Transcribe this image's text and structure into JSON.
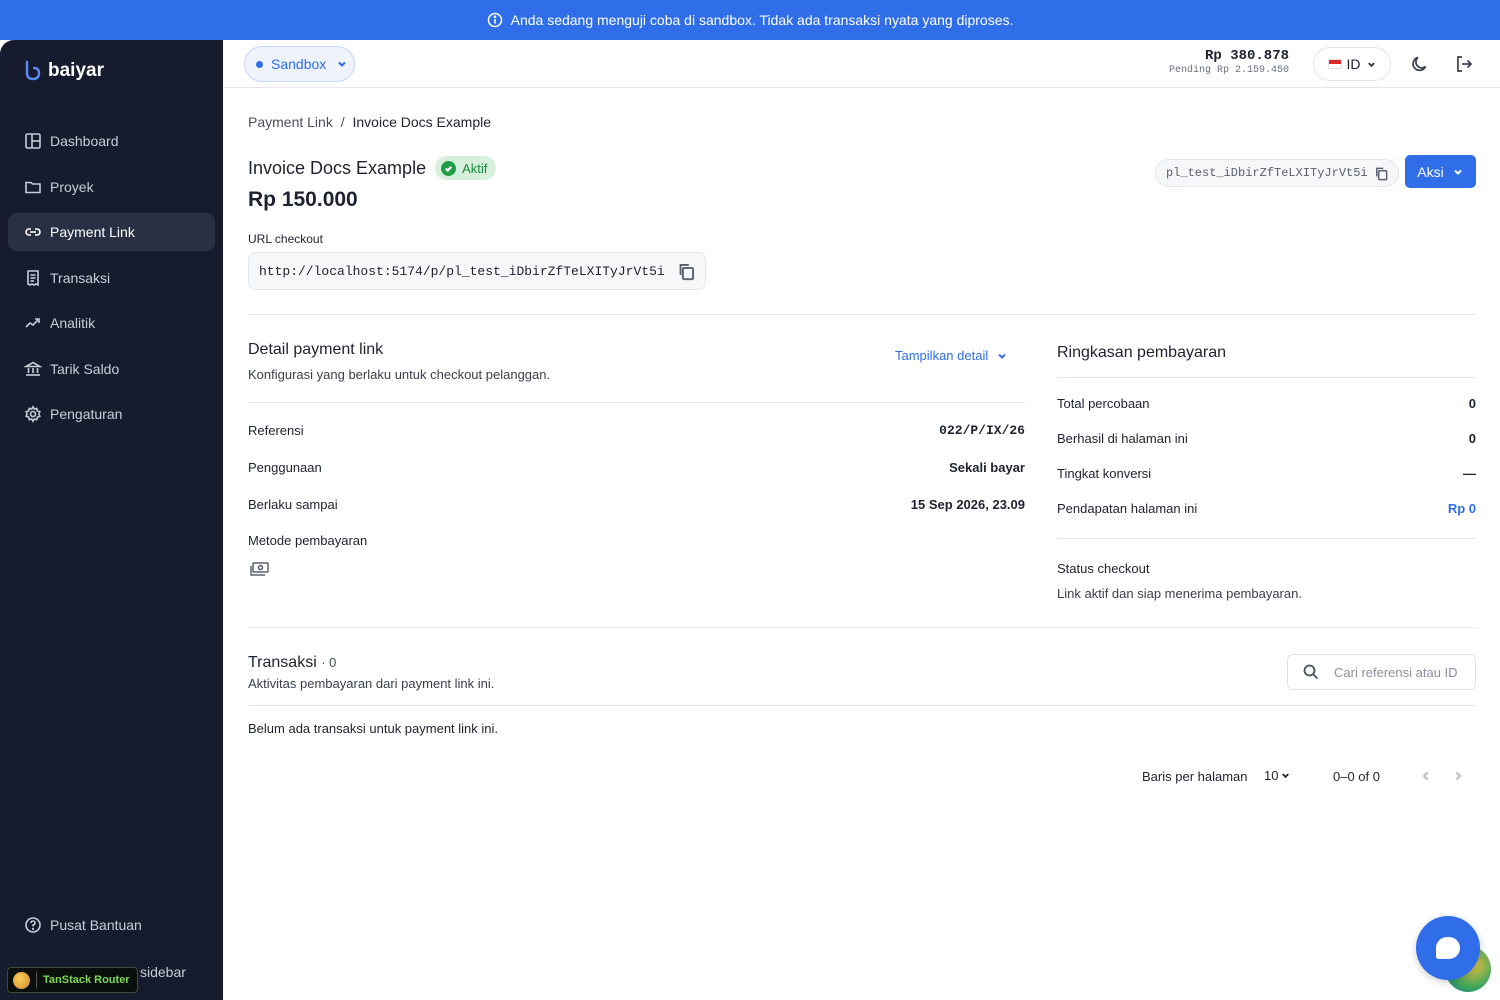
{
  "banner": {
    "text": "Anda sedang menguji coba di sandbox. Tidak ada transaksi nyata yang diproses."
  },
  "brand": {
    "name": "baiyar"
  },
  "sidebar": {
    "items": [
      {
        "label": "Dashboard",
        "icon": "layout-icon"
      },
      {
        "label": "Proyek",
        "icon": "folder-icon"
      },
      {
        "label": "Payment Link",
        "icon": "link-icon",
        "active": true
      },
      {
        "label": "Transaksi",
        "icon": "receipt-icon"
      },
      {
        "label": "Analitik",
        "icon": "trend-icon"
      },
      {
        "label": "Tarik Saldo",
        "icon": "bank-icon"
      },
      {
        "label": "Pengaturan",
        "icon": "gear-icon"
      }
    ],
    "help_label": "Pusat Bantuan",
    "toggle_label": "sidebar"
  },
  "devtools": {
    "label": "TanStack Router"
  },
  "topbar": {
    "env_label": "Sandbox",
    "balance": "Rp 380.878",
    "pending": "Pending Rp 2.159.450",
    "language": "ID"
  },
  "breadcrumb": {
    "parent": "Payment Link",
    "separator": "/",
    "current": "Invoice Docs Example"
  },
  "link": {
    "title": "Invoice Docs Example",
    "status": "Aktif",
    "amount": "Rp 150.000",
    "id": "pl_test_iDbirZfTeLXITyJrVt5i",
    "action_label": "Aksi",
    "url_label": "URL checkout",
    "url": "http://localhost:5174/p/pl_test_iDbirZfTeLXITyJrVt5i"
  },
  "detail": {
    "title": "Detail payment link",
    "subtitle": "Konfigurasi yang berlaku untuk checkout pelanggan.",
    "toggle_label": "Tampilkan detail",
    "rows": [
      {
        "label": "Referensi",
        "value": "022/P/IX/26"
      },
      {
        "label": "Penggunaan",
        "value": "Sekali bayar"
      },
      {
        "label": "Berlaku sampai",
        "value": "15 Sep 2026, 23.09"
      }
    ],
    "method_label": "Metode pembayaran"
  },
  "summary": {
    "title": "Ringkasan pembayaran",
    "rows": [
      {
        "label": "Total percobaan",
        "value": "0"
      },
      {
        "label": "Berhasil di halaman ini",
        "value": "0"
      },
      {
        "label": "Tingkat konversi",
        "value": "—"
      },
      {
        "label": "Pendapatan halaman ini",
        "value": "Rp 0"
      }
    ],
    "status_title": "Status checkout",
    "status_text": "Link aktif dan siap menerima pembayaran."
  },
  "transactions": {
    "title": "Transaksi",
    "count": "· 0",
    "subtitle": "Aktivitas pembayaran dari payment link ini.",
    "search_placeholder": "Cari referensi atau ID",
    "empty": "Belum ada transaksi untuk payment link ini.",
    "rows_per_page_label": "Baris per halaman",
    "rows_per_page": "10",
    "range": "0–0 of 0"
  },
  "colors": {
    "accent": "#2f6ee8",
    "sidebar": "#161b2e",
    "success": "#1f9d47"
  }
}
